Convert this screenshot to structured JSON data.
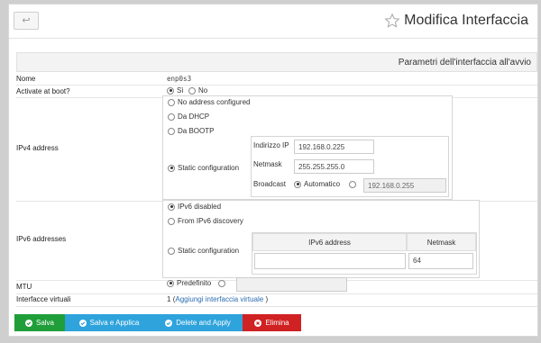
{
  "header": {
    "back_label": "↩",
    "title": "Modifica Interfaccia"
  },
  "section": {
    "title": "Parametri dell'interfaccia all'avvio"
  },
  "rows": {
    "name": {
      "label": "Nome",
      "value": "enp0s3"
    },
    "boot": {
      "label": "Activate at boot?",
      "opt_yes": "Sì",
      "opt_no": "No"
    },
    "ipv4": {
      "label": "IPv4 address",
      "opt_none": "No address configured",
      "opt_dhcp": "Da DHCP",
      "opt_bootp": "Da BOOTP",
      "opt_static": "Static configuration",
      "ip_label": "Indirizzo IP",
      "ip_value": "192.168.0.225",
      "netmask_label": "Netmask",
      "netmask_value": "255.255.255.0",
      "broadcast_label": "Broadcast",
      "broadcast_auto": "Automatico",
      "broadcast_value": "192.168.0.255"
    },
    "ipv6": {
      "label": "IPv6 addresses",
      "opt_disabled": "IPv6 disabled",
      "opt_discovery": "From IPv6 discovery",
      "opt_static": "Static configuration",
      "col_address": "IPv6 address",
      "col_netmask": "Netmask",
      "netmask_value": "64"
    },
    "mtu": {
      "label": "MTU",
      "opt_default": "Predefinito"
    },
    "virtual": {
      "label": "Interfacce virtuali",
      "count": "1",
      "link_open": "(",
      "link": "Aggiungi interfaccia virtuale",
      "link_close": ")"
    }
  },
  "buttons": {
    "save": "Salva",
    "save_apply": "Salva e Applica",
    "delete_apply": "Delete and Apply",
    "delete": "Elimina"
  },
  "colors": {
    "save": "#1f9e3a",
    "apply": "#2ea3dc",
    "delete": "#d02222"
  }
}
